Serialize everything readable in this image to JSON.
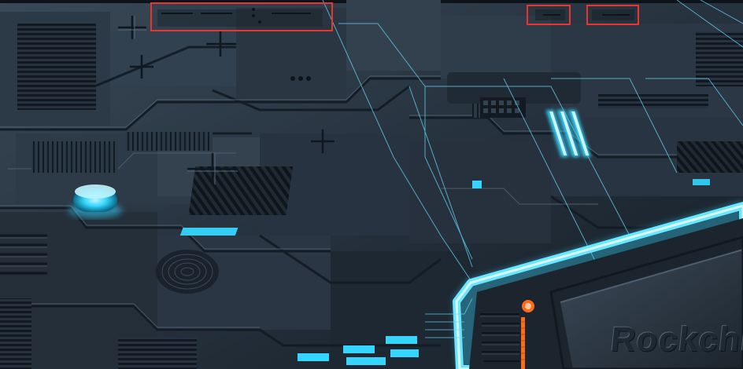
{
  "scene": {
    "chip_label": "Rockchi",
    "palette": {
      "board": "#26323e",
      "board_dark": "#151d25",
      "glow": "#34d6ff",
      "glow_soft": "#7fe9ff",
      "highlight_box": "#e8352f",
      "accent_orange": "#ff6a1a"
    }
  },
  "highlights": [
    {
      "name": "top-left-panel-box"
    },
    {
      "name": "top-right-small-box"
    },
    {
      "name": "top-right-wide-box"
    }
  ]
}
